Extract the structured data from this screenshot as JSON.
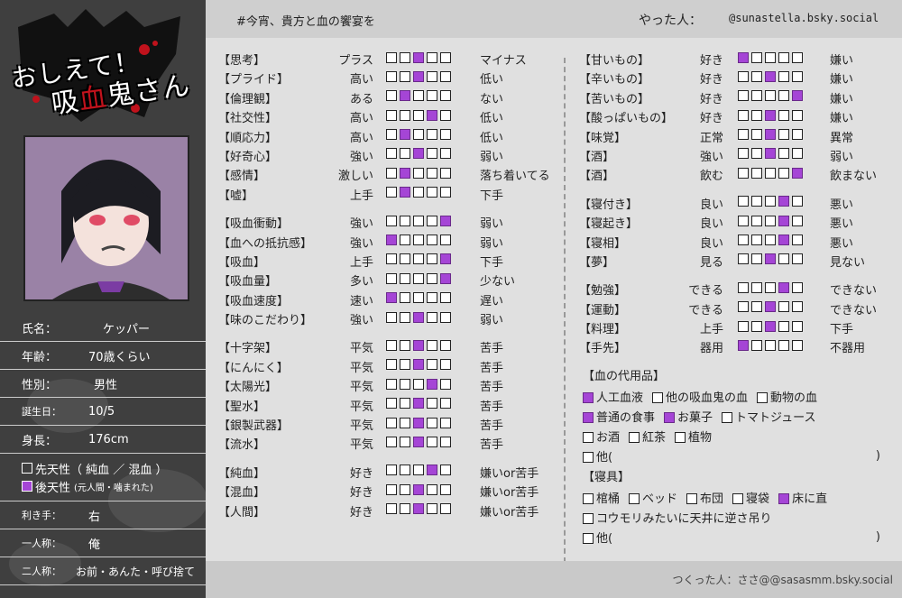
{
  "title": {
    "line1": "おしえて！",
    "line2_pre": "吸",
    "line2_red": "血",
    "line2_post": "鬼さん"
  },
  "header": {
    "hashtag": "#今宵、貴方と血の饗宴を",
    "done_label": "やった人：",
    "done_value": "@sunastella.bsky.social"
  },
  "profile": {
    "name_label": "氏名：",
    "name": "ケッパー",
    "age_label": "年齢：",
    "age": "70歳くらい",
    "sex_label": "性別：",
    "sex": "男性",
    "birthday_label": "誕生日：",
    "birthday": "10/5",
    "height_label": "身長：",
    "height": "176cm",
    "origin_born": "先天性（ 純血 ／ 混血 ）",
    "origin_after": "後天性",
    "origin_after_note": "(元人間・噛まれた)",
    "hand_label": "利き手：",
    "hand": "右",
    "first_person_label": "一人称：",
    "first_person": "俺",
    "second_person_label": "二人称：",
    "second_person": "お前・あんた・呼び捨て"
  },
  "left_groups": [
    [
      {
        "key": "【思考】",
        "l": "プラス",
        "r": "マイナス",
        "level": 3
      },
      {
        "key": "【プライド】",
        "l": "高い",
        "r": "低い",
        "level": 3
      },
      {
        "key": "【倫理観】",
        "l": "ある",
        "r": "ない",
        "level": 2
      },
      {
        "key": "【社交性】",
        "l": "高い",
        "r": "低い",
        "level": 4
      },
      {
        "key": "【順応力】",
        "l": "高い",
        "r": "低い",
        "level": 2
      },
      {
        "key": "【好奇心】",
        "l": "強い",
        "r": "弱い",
        "level": 3
      },
      {
        "key": "【感情】",
        "l": "激しい",
        "r": "落ち着いてる",
        "level": 2
      },
      {
        "key": "【嘘】",
        "l": "上手",
        "r": "下手",
        "level": 2
      }
    ],
    [
      {
        "key": "【吸血衝動】",
        "l": "強い",
        "r": "弱い",
        "level": 5
      },
      {
        "key": "【血への抵抗感】",
        "l": "強い",
        "r": "弱い",
        "level": 1
      },
      {
        "key": "【吸血】",
        "l": "上手",
        "r": "下手",
        "level": 5
      },
      {
        "key": "【吸血量】",
        "l": "多い",
        "r": "少ない",
        "level": 5
      },
      {
        "key": "【吸血速度】",
        "l": "速い",
        "r": "遅い",
        "level": 1
      },
      {
        "key": "【味のこだわり】",
        "l": "強い",
        "r": "弱い",
        "level": 3
      }
    ],
    [
      {
        "key": "【十字架】",
        "l": "平気",
        "r": "苦手",
        "level": 3
      },
      {
        "key": "【にんにく】",
        "l": "平気",
        "r": "苦手",
        "level": 3
      },
      {
        "key": "【太陽光】",
        "l": "平気",
        "r": "苦手",
        "level": 4
      },
      {
        "key": "【聖水】",
        "l": "平気",
        "r": "苦手",
        "level": 3
      },
      {
        "key": "【銀製武器】",
        "l": "平気",
        "r": "苦手",
        "level": 3
      },
      {
        "key": "【流水】",
        "l": "平気",
        "r": "苦手",
        "level": 3
      }
    ],
    [
      {
        "key": "【純血】",
        "l": "好き",
        "r": "嫌いor苦手",
        "level": 4
      },
      {
        "key": "【混血】",
        "l": "好き",
        "r": "嫌いor苦手",
        "level": 3
      },
      {
        "key": "【人間】",
        "l": "好き",
        "r": "嫌いor苦手",
        "level": 3
      }
    ]
  ],
  "right_groups": [
    [
      {
        "key": "【甘いもの】",
        "l": "好き",
        "r": "嫌い",
        "level": 1
      },
      {
        "key": "【辛いもの】",
        "l": "好き",
        "r": "嫌い",
        "level": 3
      },
      {
        "key": "【苦いもの】",
        "l": "好き",
        "r": "嫌い",
        "level": 5
      },
      {
        "key": "【酸っぱいもの】",
        "l": "好き",
        "r": "嫌い",
        "level": 3
      },
      {
        "key": "【味覚】",
        "l": "正常",
        "r": "異常",
        "level": 3
      },
      {
        "key": "【酒】",
        "l": "強い",
        "r": "弱い",
        "level": 3
      },
      {
        "key": "【酒】",
        "l": "飲む",
        "r": "飲まない",
        "level": 5
      }
    ],
    [
      {
        "key": "【寝付き】",
        "l": "良い",
        "r": "悪い",
        "level": 4
      },
      {
        "key": "【寝起き】",
        "l": "良い",
        "r": "悪い",
        "level": 4
      },
      {
        "key": "【寝相】",
        "l": "良い",
        "r": "悪い",
        "level": 4
      },
      {
        "key": "【夢】",
        "l": "見る",
        "r": "見ない",
        "level": 3
      }
    ],
    [
      {
        "key": "【勉強】",
        "l": "できる",
        "r": "できない",
        "level": 4
      },
      {
        "key": "【運動】",
        "l": "できる",
        "r": "できない",
        "level": 3
      },
      {
        "key": "【料理】",
        "l": "上手",
        "r": "下手",
        "level": 3
      },
      {
        "key": "【手先】",
        "l": "器用",
        "r": "不器用",
        "level": 1
      }
    ]
  ],
  "substitute": {
    "heading": "【血の代用品】",
    "lines": [
      [
        {
          "label": "人工血液",
          "on": true
        },
        {
          "label": "他の吸血鬼の血",
          "on": false
        },
        {
          "label": "動物の血",
          "on": false
        }
      ],
      [
        {
          "label": "普通の食事",
          "on": true
        },
        {
          "label": "お菓子",
          "on": true
        },
        {
          "label": "トマトジュース",
          "on": false
        }
      ],
      [
        {
          "label": "お酒",
          "on": false
        },
        {
          "label": "紅茶",
          "on": false
        },
        {
          "label": "植物",
          "on": false
        }
      ]
    ],
    "other": "他(",
    "other_close": ")"
  },
  "bedding": {
    "heading": "【寝具】",
    "lines": [
      [
        {
          "label": "棺桶",
          "on": false
        },
        {
          "label": "ベッド",
          "on": false
        },
        {
          "label": "布団",
          "on": false
        },
        {
          "label": "寝袋",
          "on": false
        },
        {
          "label": "床に直",
          "on": true
        }
      ],
      [
        {
          "label": "コウモリみたいに天井に逆さ吊り",
          "on": false
        }
      ]
    ],
    "other": "他(",
    "other_close": ")"
  },
  "footer": {
    "credit": "つくった人：ささ@@sasasmm.bsky.social"
  },
  "colors": {
    "accent": "#a545d6",
    "sidebar": "#3f3f3f",
    "blood": "#c0121c"
  }
}
